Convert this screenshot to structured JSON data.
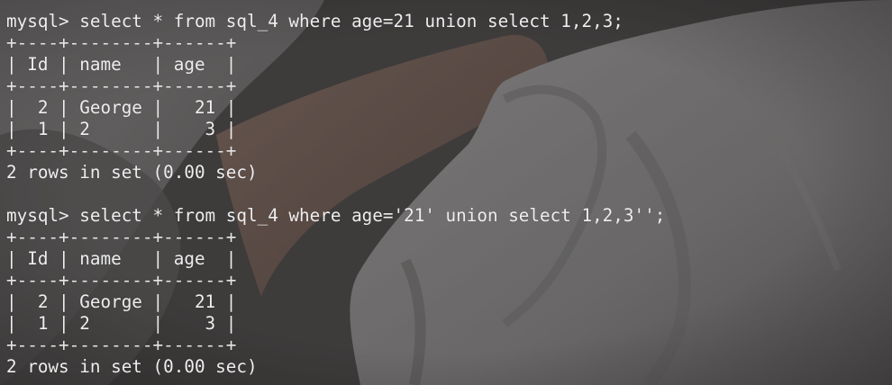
{
  "terminal": {
    "lines": [
      "mysql> select * from sql_4 where age=21 union select 1,2,3;",
      "+----+--------+------+",
      "| Id | name   | age  |",
      "+----+--------+------+",
      "|  2 | George |   21 |",
      "|  1 | 2      |    3 |",
      "+----+--------+------+",
      "2 rows in set (0.00 sec)",
      "",
      "mysql> select * from sql_4 where age='21' union select 1,2,3'';",
      "+----+--------+------+",
      "| Id | name   | age  |",
      "+----+--------+------+",
      "|  2 | George |   21 |",
      "|  1 | 2      |    3 |",
      "+----+--------+------+",
      "2 rows in set (0.00 sec)"
    ]
  }
}
